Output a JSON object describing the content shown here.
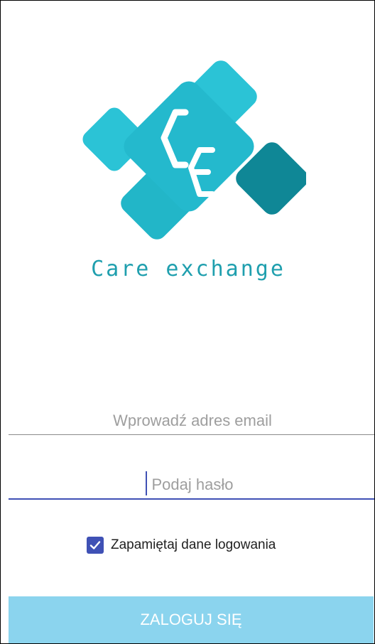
{
  "brand": {
    "name": "Care exchange"
  },
  "form": {
    "email_placeholder": "Wprowadź adres email",
    "password_placeholder": "Podaj hasło",
    "remember_checked": true,
    "remember_label": "Zapamiętaj dane logowania",
    "login_button": "ZALOGUJ SIĘ"
  },
  "colors": {
    "accent": "#3f51b5",
    "button_bg": "#8bd4ee",
    "logo_light": "#26c6da",
    "logo_dark": "#0f8796"
  },
  "icons": {
    "logo": "care-exchange-logo-icon",
    "checkbox": "check-icon"
  }
}
